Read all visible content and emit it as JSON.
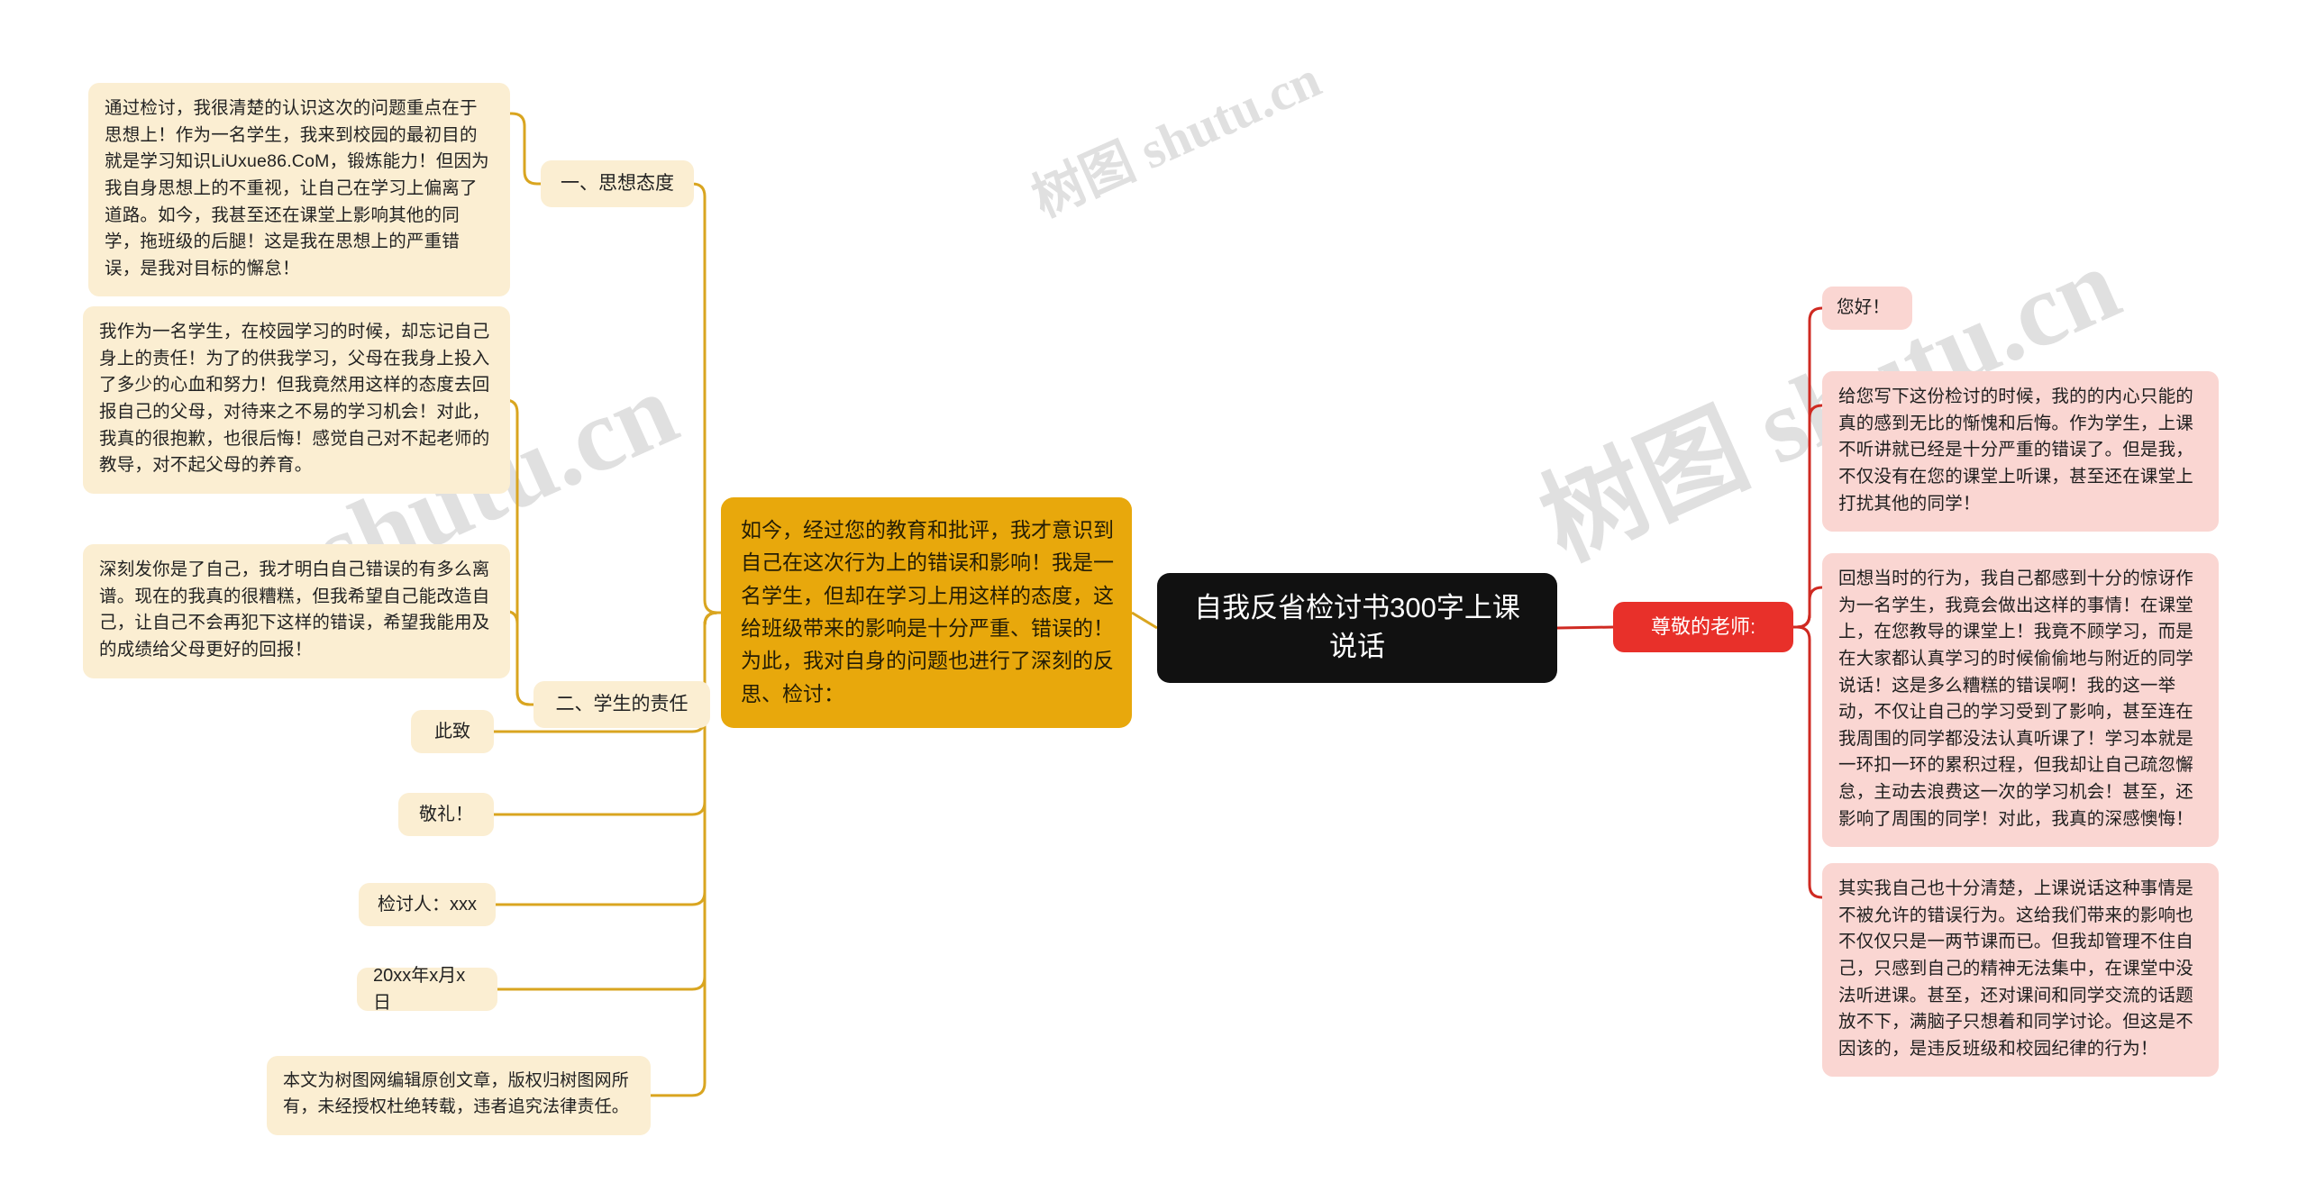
{
  "document": {
    "type": "mindmap",
    "watermarks": [
      "shutu.cn",
      "树图 shutu.cn",
      "树图 shutu.cn"
    ],
    "colors": {
      "root_bg": "#111111",
      "root_text": "#ffffff",
      "branch_left_line": "#d9a520",
      "branch_right_line": "#cf2a22",
      "orange_node": "#e8a80c",
      "cream_node": "#fbeed2",
      "red_node": "#e8302a",
      "pink_node": "#fad6d2",
      "page_bg": "#ffffff"
    }
  },
  "root": {
    "title": "自我反省检讨书300字上课说话"
  },
  "left_branch": {
    "summary": "如今，经过您的教育和批评，我才意识到自己在这次行为上的错误和影响！我是一名学生，但却在学习上用这样的态度，这给班级带来的影响是十分严重、错误的！为此，我对自身的问题也进行了深刻的反思、检讨：",
    "topics": [
      {
        "label": "一、思想态度",
        "detail": "通过检讨，我很清楚的认识这次的问题重点在于思想上！作为一名学生，我来到校园的最初目的就是学习知识LiUxue86.CoM，锻炼能力！但因为我自身思想上的不重视，让自己在学习上偏离了道路。如今，我甚至还在课堂上影响其他的同学，拖班级的后腿！这是我在思想上的严重错误，是我对目标的懈怠！"
      },
      {
        "label": "二、学生的责任",
        "details": [
          "我作为一名学生，在校园学习的时候，却忘记自己身上的责任！为了的供我学习，父母在我身上投入了多少的心血和努力！但我竟然用这样的态度去回报自己的父母，对待来之不易的学习机会！对此，我真的很抱歉，也很后悔！感觉自己对不起老师的教导，对不起父母的养育。",
          "深刻发你是了自己，我才明白自己错误的有多么离谱。现在的我真的很糟糕，但我希望自己能改造自己，让自己不会再犯下这样的错误，希望我能用及的成绩给父母更好的回报！"
        ]
      }
    ],
    "closing_items": [
      "此致",
      "敬礼！",
      "检讨人：xxx",
      "20xx年x月x日"
    ],
    "copyright": "本文为树图网编辑原创文章，版权归树图网所有，未经授权杜绝转载，违者追究法律责任。"
  },
  "right_branch": {
    "label": "尊敬的老师:",
    "items": [
      "您好！",
      "给您写下这份检讨的时候，我的的内心只能的真的感到无比的惭愧和后悔。作为学生，上课不听讲就已经是十分严重的错误了。但是我，不仅没有在您的课堂上听课，甚至还在课堂上打扰其他的同学！",
      "回想当时的行为，我自己都感到十分的惊讶作为一名学生，我竟会做出这样的事情！在课堂上，在您教导的课堂上！我竟不顾学习，而是在大家都认真学习的时候偷偷地与附近的同学说话！这是多么糟糕的错误啊！我的这一举动，不仅让自己的学习受到了影响，甚至连在我周围的同学都没法认真听课了！学习本就是一环扣一环的累积过程，但我却让自己疏忽懈怠，主动去浪费这一次的学习机会！甚至，还影响了周围的同学！对此，我真的深感懊悔！",
      "其实我自己也十分清楚，上课说话这种事情是不被允许的错误行为。这给我们带来的影响也不仅仅只是一两节课而已。但我却管理不住自己，只感到自己的精神无法集中，在课堂中没法听进课。甚至，还对课间和同学交流的话题放不下，满脑子只想着和同学讨论。但这是不因该的，是违反班级和校园纪律的行为！"
    ]
  }
}
